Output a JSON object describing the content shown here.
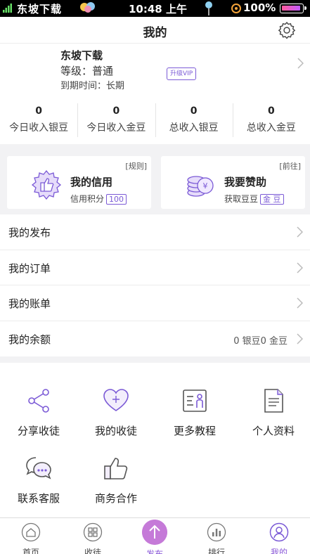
{
  "status_bar": {
    "carrier": "东坡下载",
    "time": "10:48 上午",
    "battery": "100%"
  },
  "header": {
    "title": "我的",
    "settings_icon": "gear-icon"
  },
  "profile": {
    "name": "东坡下载",
    "level": "等级：普通",
    "expire": "到期时间：长期",
    "vip_button": "升级VIP"
  },
  "stats": [
    {
      "value": "0",
      "label": "今日收入银豆"
    },
    {
      "value": "0",
      "label": "今日收入金豆"
    },
    {
      "value": "0",
      "label": "总收入银豆"
    },
    {
      "value": "0",
      "label": "总收入金豆"
    }
  ],
  "cards": {
    "credit": {
      "tag": "[规则]",
      "title": "我的信用",
      "sub_label": "信用积分",
      "sub_value": "100",
      "icon": "thumbs-up-badge-icon"
    },
    "sponsor": {
      "tag": "[前往]",
      "title": "我要赞助",
      "sub_label": "获取豆豆",
      "sub_value": "金 豆",
      "icon": "coins-icon"
    }
  },
  "list": [
    {
      "label": "我的发布",
      "value": ""
    },
    {
      "label": "我的订单",
      "value": ""
    },
    {
      "label": "我的账单",
      "value": ""
    },
    {
      "label": "我的余额",
      "value": "0 银豆0 金豆"
    }
  ],
  "grid": [
    {
      "label": "分享收徒",
      "icon": "share-icon"
    },
    {
      "label": "我的收徒",
      "icon": "heart-plus-icon"
    },
    {
      "label": "更多教程",
      "icon": "tutorial-icon"
    },
    {
      "label": "个人资料",
      "icon": "document-icon"
    },
    {
      "label": "联系客服",
      "icon": "chat-bubbles-icon"
    },
    {
      "label": "商务合作",
      "icon": "thumbs-up-icon"
    }
  ],
  "tabbar": [
    {
      "label": "首页",
      "icon": "home-icon"
    },
    {
      "label": "收徒",
      "icon": "apprentice-icon"
    },
    {
      "label": "发布",
      "icon": "upload-arrow-icon"
    },
    {
      "label": "排行",
      "icon": "bar-chart-icon"
    },
    {
      "label": "我的",
      "icon": "user-icon"
    }
  ],
  "colors": {
    "accent": "#7b5ad6",
    "publish": "#c57ad8"
  }
}
